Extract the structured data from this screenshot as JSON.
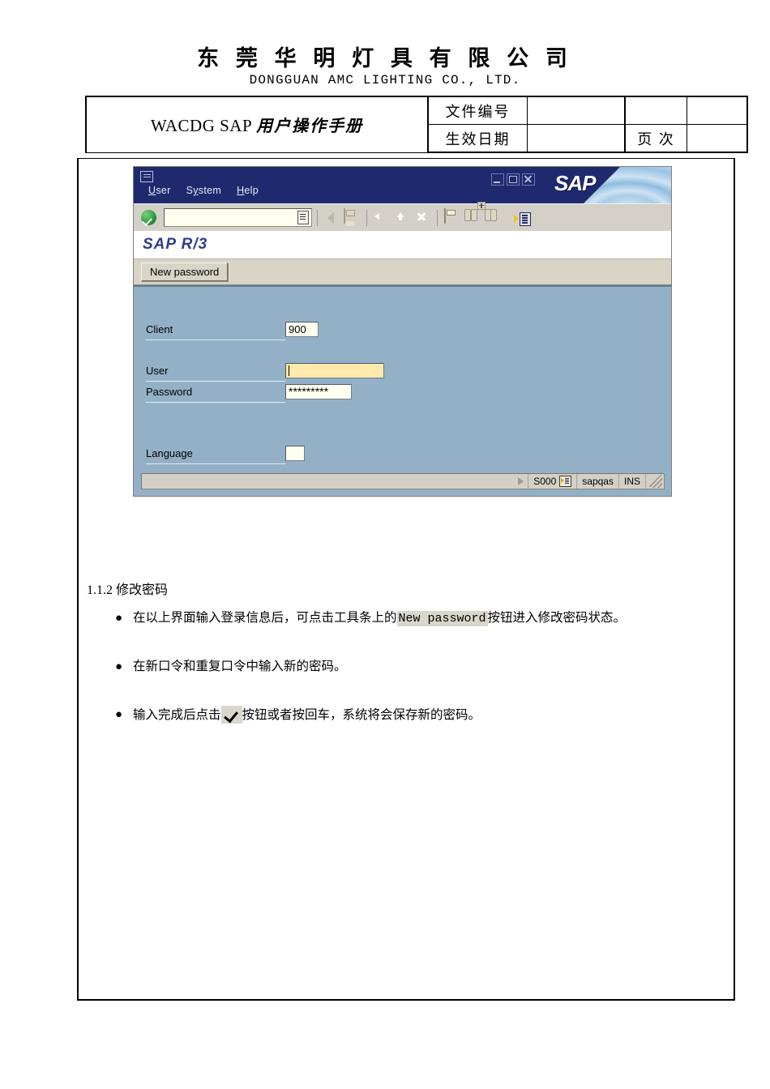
{
  "document": {
    "company_cn": "东 莞 华 明 灯 具 有 限 公 司",
    "company_en": "DONGGUAN AMC LIGHTING CO., LTD.",
    "header_table": {
      "title_prefix": "WACDG SAP ",
      "title_cn": "用户操作手册",
      "label_doc_no": "文件编号",
      "value_doc_no": "",
      "label_effective_date": "生效日期",
      "value_effective_date": "",
      "label_page": "页  次",
      "value_page": "",
      "value_extra_top": ""
    },
    "section": {
      "number_title": "1.1.2 修改密码"
    },
    "bullets": [
      {
        "marker": "●",
        "text_before": "在以上界面输入登录信息后，可点击工具条上的",
        "chip": "New password",
        "text_after": "按钮进入修改密码状态。"
      },
      {
        "marker": "●",
        "text_before": "在新口令和重复口令中输入新的密码。",
        "chip": "",
        "text_after": ""
      },
      {
        "marker": "●",
        "text_before": "输入完成后点击",
        "chip": "check-icon",
        "text_after": "按钮或者按回车，系统将会保存新的密码。"
      }
    ]
  },
  "sap_window": {
    "menus": [
      {
        "label": "User",
        "mnemonic": "U"
      },
      {
        "label": "System",
        "mnemonic": "y"
      },
      {
        "label": "Help",
        "mnemonic": "H"
      }
    ],
    "menu_user_pre": "",
    "menu_user_post": "ser",
    "menu_system_pre": "S",
    "menu_system_post": "stem",
    "menu_help_pre": "",
    "menu_help_post": "elp",
    "brand": "SAP",
    "window_buttons": [
      "minimize",
      "maximize",
      "close"
    ],
    "command_field_value": "",
    "toolbar_icons": [
      "enter-ok-icon",
      "back-triangle-icon",
      "save-icon",
      "back-arrow-icon",
      "exit-up-icon",
      "cancel-x-icon",
      "print-icon",
      "find-icon",
      "find-next-icon",
      "create-session-icon"
    ],
    "screen_title": "SAP R/3",
    "app_toolbar": {
      "new_password_button": "New password"
    },
    "login_form": {
      "client_label": "Client",
      "client_value": "900",
      "user_label": "User",
      "user_value": "",
      "password_label": "Password",
      "password_value": "*********",
      "language_label": "Language",
      "language_value": ""
    },
    "status_bar": {
      "message": "",
      "system": "S000",
      "server": "sapqas",
      "mode": "INS"
    }
  },
  "colors": {
    "titlebar_blue": "#1f2a6e",
    "panel_blue": "#93b0c6",
    "toolbar_grey": "#d4d0c8",
    "focus_yellow": "#ffe9ab",
    "r3_title_blue": "#313c8c"
  }
}
